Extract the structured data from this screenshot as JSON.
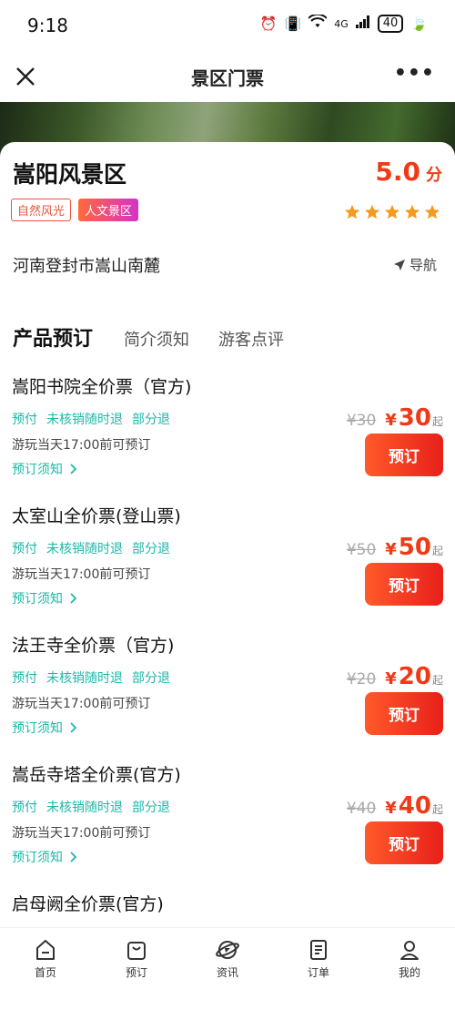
{
  "status_bar": {
    "time": "9:18",
    "signal": "4G",
    "battery": "40"
  },
  "nav": {
    "title": "景区门票"
  },
  "scenic": {
    "name": "嵩阳风景区",
    "score": "5.0",
    "score_unit": "分",
    "tags": [
      "自然风光",
      "人文景区"
    ],
    "stars": 5,
    "address": "河南登封市嵩山南麓",
    "navigate_label": "导航"
  },
  "tabs": [
    "产品预订",
    "简介须知",
    "游客点评"
  ],
  "products": [
    {
      "name": "嵩阳书院全价票（官方)",
      "features": [
        "预付",
        "未核销随时退",
        "部分退"
      ],
      "time_note": "游玩当天17:00前可预订",
      "notice": "预订须知",
      "orig_price": "¥30",
      "currency": "¥",
      "price": "30",
      "qi": "起",
      "book": "预订"
    },
    {
      "name": "太室山全价票(登山票)",
      "features": [
        "预付",
        "未核销随时退",
        "部分退"
      ],
      "time_note": "游玩当天17:00前可预订",
      "notice": "预订须知",
      "orig_price": "¥50",
      "currency": "¥",
      "price": "50",
      "qi": "起",
      "book": "预订"
    },
    {
      "name": "法王寺全价票（官方)",
      "features": [
        "预付",
        "未核销随时退",
        "部分退"
      ],
      "time_note": "游玩当天17:00前可预订",
      "notice": "预订须知",
      "orig_price": "¥20",
      "currency": "¥",
      "price": "20",
      "qi": "起",
      "book": "预订"
    },
    {
      "name": "嵩岳寺塔全价票(官方)",
      "features": [
        "预付",
        "未核销随时退",
        "部分退"
      ],
      "time_note": "游玩当天17:00前可预订",
      "notice": "预订须知",
      "orig_price": "¥40",
      "currency": "¥",
      "price": "40",
      "qi": "起",
      "book": "预订"
    },
    {
      "name": "启母阙全价票(官方)"
    }
  ],
  "tabbar": [
    {
      "label": "首页",
      "icon": "home-icon"
    },
    {
      "label": "预订",
      "icon": "bag-icon"
    },
    {
      "label": "资讯",
      "icon": "planet-icon"
    },
    {
      "label": "订单",
      "icon": "document-icon"
    },
    {
      "label": "我的",
      "icon": "user-icon"
    }
  ]
}
